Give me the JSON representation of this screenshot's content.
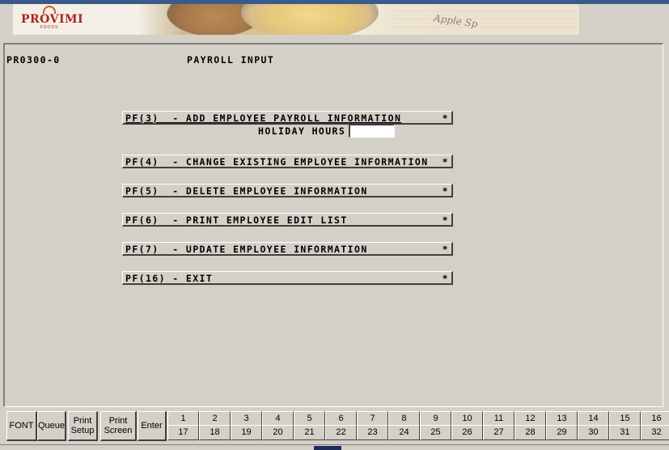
{
  "banner": {
    "logo_name": "PROVIMI",
    "logo_sub": "FOODS",
    "script_text": "Apple Sp"
  },
  "screen": {
    "program_id": "PR0300-0",
    "title": "PAYROLL INPUT"
  },
  "menu": {
    "items": [
      {
        "label": "PF(3)  - ADD EMPLOYEE PAYROLL INFORMATION",
        "star": "*"
      },
      {
        "label": "PF(4)  - CHANGE EXISTING EMPLOYEE INFORMATION",
        "star": "*"
      },
      {
        "label": "PF(5)  - DELETE EMPLOYEE INFORMATION",
        "star": "*"
      },
      {
        "label": "PF(6)  - PRINT EMPLOYEE EDIT LIST",
        "star": "*"
      },
      {
        "label": "PF(7)  - UPDATE EMPLOYEE INFORMATION",
        "star": "*"
      },
      {
        "label": "PF(16) - EXIT",
        "star": "*"
      }
    ]
  },
  "holiday": {
    "label": "HOLIDAY HOURS",
    "value": ""
  },
  "toolbar": {
    "font": "FONT",
    "queue": "Queue",
    "print_setup_1": "Print",
    "print_setup_2": "Setup",
    "print_screen_1": "Print",
    "print_screen_2": "Screen",
    "enter": "Enter",
    "fkeys_top": [
      "1",
      "2",
      "3",
      "4",
      "5",
      "6",
      "7",
      "8",
      "9",
      "10",
      "11",
      "12",
      "13",
      "14",
      "15",
      "16"
    ],
    "fkeys_bottom": [
      "17",
      "18",
      "19",
      "20",
      "21",
      "22",
      "23",
      "24",
      "25",
      "26",
      "27",
      "28",
      "29",
      "30",
      "31",
      "32"
    ]
  },
  "colors": {
    "background": "#d4d0c8",
    "brand_red": "#b0241f",
    "input_bg": "#ffffff"
  }
}
